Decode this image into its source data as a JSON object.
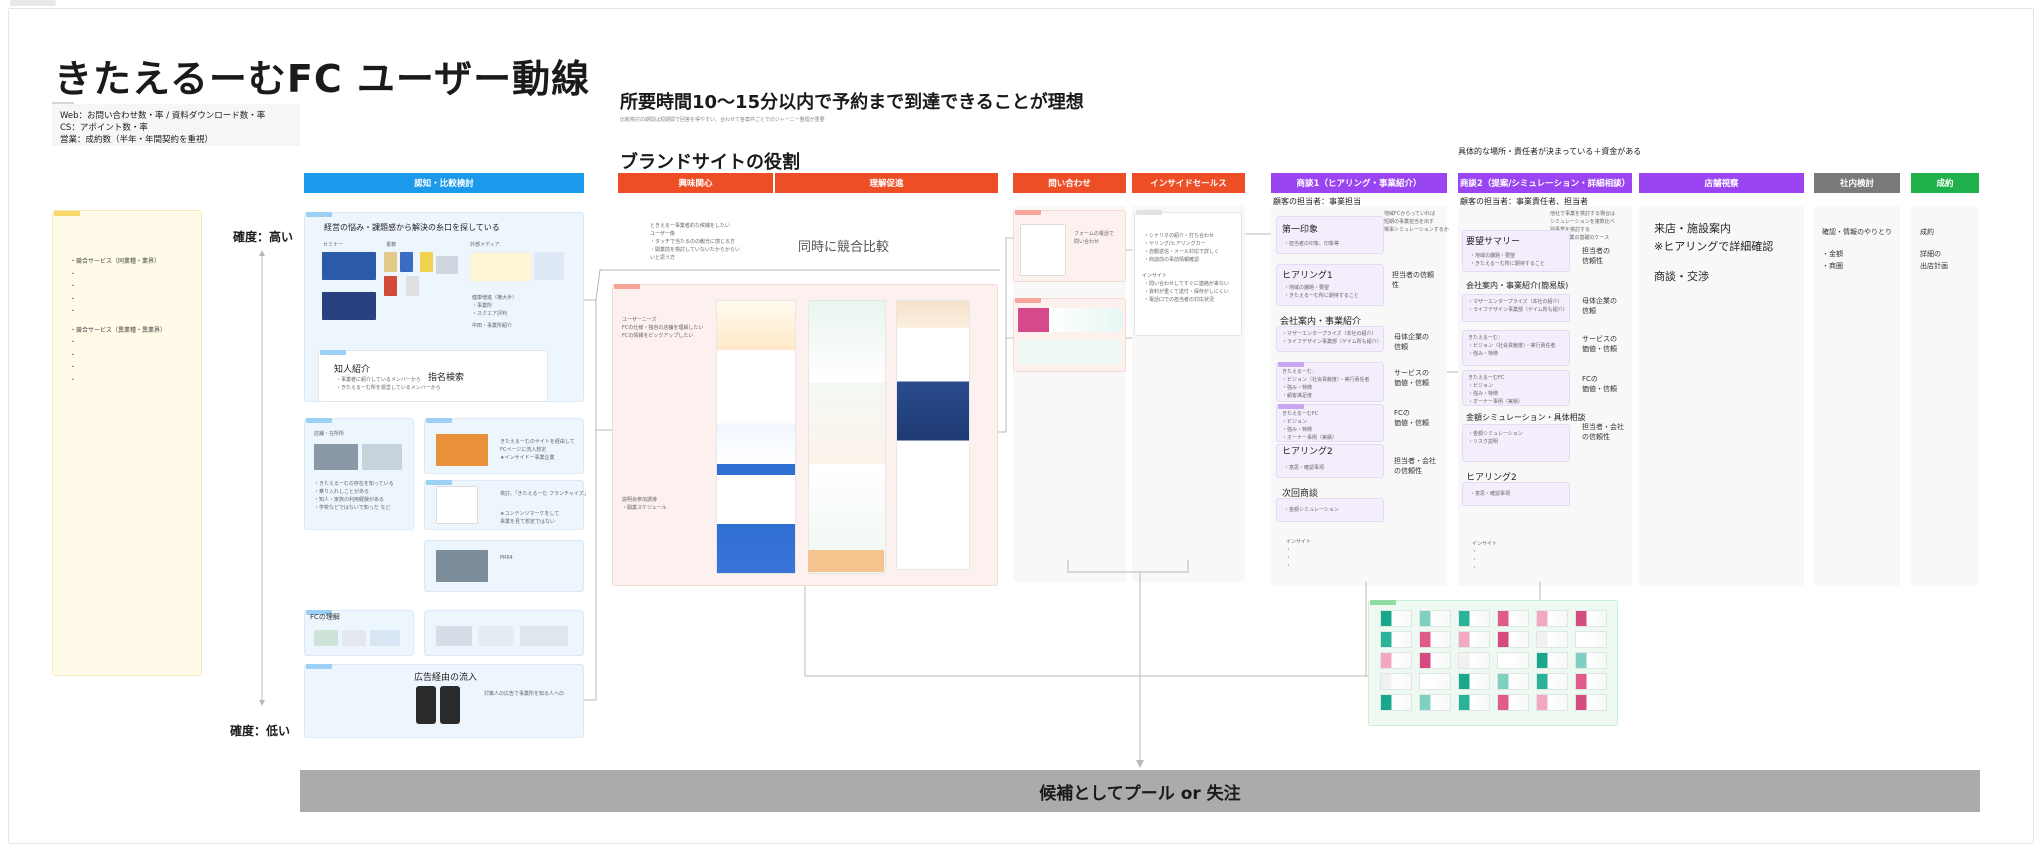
{
  "title": "きたえるーむFC ユーザー動線",
  "kpi": {
    "lines": [
      "Web：お問い合わせ数・率 / 資料ダウンロード数・率",
      "CS：アポイント数・率",
      "営業：成約数（半年・年間契約を重視）"
    ]
  },
  "lead": {
    "headline": "所要時間10〜15分以内で予約まで到達できることが理想",
    "sub": "比較検討の期間は短期間で回答を得やすい、合わせて各案件ごとでのジャーニー整理が重要"
  },
  "brand_heading": "ブランドサイトの役割",
  "precondition": "具体的な場所・責任者が決まっている＋資金がある",
  "confidence": {
    "high": "確度：高い",
    "low": "確度：低い"
  },
  "stages": [
    {
      "label": "認知・比較検討",
      "color": "#1b9aec"
    },
    {
      "label": "興味関心",
      "color": "#ee4e26"
    },
    {
      "label": "理解促進",
      "color": "#ee4e26"
    },
    {
      "label": "問い合わせ",
      "color": "#ee4e26"
    },
    {
      "label": "インサイドセールス",
      "color": "#ee4e26"
    },
    {
      "label": "商談1（ヒアリング・事業紹介）",
      "color": "#9b45f2"
    },
    {
      "label": "商談2（提案/シミュレーション・詳細相談）",
      "color": "#9b45f2"
    },
    {
      "label": "店舗視察",
      "color": "#9b45f2"
    },
    {
      "label": "社内検討",
      "color": "#7a7a7a"
    },
    {
      "label": "成約",
      "color": "#1fb24c"
    }
  ],
  "competitors": {
    "items": [
      "・競合サービス（同業種・業界）",
      "・",
      "・",
      "・",
      "・",
      "・競合サービス（異業種・異業界）",
      "・",
      "・",
      "・",
      "・"
    ]
  },
  "awareness": {
    "main_heading": "経営の悩み・課題感から解決の糸口を探している",
    "labels": {
      "seminar": "セミナー",
      "books": "書籍",
      "media": "外部メディア"
    },
    "media_lines": [
      "健康増進（横大手）",
      "・事業所",
      "・スクエア評判"
    ],
    "media_note": "中田・事業所紹介",
    "referral_title": "知人紹介",
    "referral_lines": [
      "・事業者に紹介しているメンバーから",
      "・きたえるーむ所を運営しているメンバーから"
    ],
    "search_label": "指名検索",
    "store_label": "店舗・在所所",
    "store_lines": [
      "・きたえるーむの存在を知っている",
      "・乗り入れしことがある",
      "・知人・家族の利用経験がある",
      "・学校などではないで知っだ など"
    ],
    "site_lines": [
      "きたえるーむのサイトを経由して",
      "FCページに流入想定",
      "★インサイドー事業企業"
    ],
    "search_query": "検討。「きたえるーむ フランチャイズ」",
    "search_notes": [
      "★コンテンツマーケをして",
      "事業を見て想定ではない"
    ],
    "press_label": "PR64",
    "fc_label": "FCの理解",
    "ad_title": "広告経由の流入",
    "ad_note": "対策人の広告で事業所を知る人への"
  },
  "compare_note": "同時に競合比較",
  "interest": {
    "lines": [
      "ときえるー事業者的な候補をしたい",
      "ユーザー像",
      "・タッチで当たるのの観光に感じる方",
      "・開業前を検討していないたからからい",
      "いと思う方"
    ],
    "tag_text": "ユーザーニーズ",
    "user_needs": [
      "ユーザーニーズ",
      "FCの仕様・独自の店舗を理解したい",
      "FCの情報をピックアップしたい"
    ],
    "schedule_lines": [
      "説明会参加誘導",
      "・開業スケジュール"
    ]
  },
  "inquiry": {
    "form_text": [
      "フォームの電話で",
      "問い合わせ"
    ]
  },
  "inside_sales": {
    "lines": [
      "・シナリオの紹介・打ち合わせ",
      "・ヤリング/ヒアリングカー",
      "・自動返信・メール対応で詳しく",
      "・商談前の事前情報確認"
    ],
    "insight_title": "インサイト",
    "insight_lines": [
      "・問い合わせしてすぐに連絡が来ない",
      "・資料が重くて送付・保存がしにくい",
      "・電話口での担当者の対応状況"
    ]
  },
  "meeting1": {
    "heading": "顧客の担当者：事業担当",
    "top_note": [
      "地域FCからっていれば",
      "短期の事業担当を出す",
      "場事シミュレーションするか"
    ],
    "first_impression": "第一印象",
    "first_lines": [
      "・担当者の印象、印象等"
    ],
    "hearing1": "ヒアリング1",
    "hearing1_lines": [
      "・地域の課題・要望",
      "・きたえるーむ所に期待すること"
    ],
    "company_intro": "会社案内・事業紹介",
    "company_lines": [
      "・マザーエンタープライズ（本社の紹介）",
      "・ライフデザイン事業部（ゲイム所も紹介）"
    ],
    "kitaeru_lines": [
      "きたえるーむ：",
      "・ビジョン（社会貢献度）・実行責任者",
      "・強み・特徴",
      "・顧客満足度"
    ],
    "fc_lines": [
      "きたえるーむFC",
      "・ビジョン",
      "・強み・特徴",
      "・オーナー事例（実績）"
    ],
    "hearing2": "ヒアリング2",
    "hearing2_lines": [
      "・意思・確認事項"
    ],
    "next_meeting": "次回商談",
    "next_lines": [
      "・金額シミュレーション"
    ],
    "trust_rep": "担当者の信頼性",
    "trust_parent": [
      "母体企業の",
      "信頼"
    ],
    "trust_service": [
      "サービスの",
      "価値・信頼"
    ],
    "trust_fc": [
      "FCの",
      "価値・信頼"
    ],
    "trust_company": [
      "担当者・会社",
      "の信頼性"
    ],
    "insight_lines": [
      "インサイト",
      "・",
      "・",
      "・"
    ]
  },
  "meeting2": {
    "heading": "顧客の担当者：事業責任者、担当者",
    "top_note": [
      "他社で事業を検討する場合は",
      "シミュレーションを複数比べ",
      "別事業を検討する",
      "★投資事業の基礎のケース"
    ],
    "summary": "要望サマリー",
    "summary_lines": [
      "・地域の課題・要望",
      "・きたえるーむ所に期待すること"
    ],
    "simple_intro": "会社案内・事業紹介(簡易版)",
    "simple_lines": [
      "・マザーエンタープライズ（本社の紹介）",
      "・ライフデザイン事業部（ゲイム所も紹介）"
    ],
    "kitaeru_lines": [
      "きたえるーむ：",
      "・ビジョン（社会貢献度）・実行責任者",
      "・強み・特徴"
    ],
    "fc_lines": [
      "きたえるーむFC",
      "・ビジョン",
      "・強み・特徴",
      "・オーナー事例（実績）"
    ],
    "simulation": "金額シミュレーション・具体相談",
    "simulation_lines": [
      "・金額シミュレーション",
      "・リスク説明"
    ],
    "hearing2": "ヒアリング2",
    "hearing2_lines": [
      "・意思・確認事項"
    ],
    "trust_rep": [
      "担当者の",
      "信頼性"
    ],
    "trust_parent": [
      "母体企業の",
      "信頼"
    ],
    "trust_service": [
      "サービスの",
      "価値・信頼"
    ],
    "trust_fc": [
      "FCの",
      "価値・信頼"
    ],
    "trust_company": [
      "担当者・会社",
      "の信頼性"
    ],
    "insight_lines": [
      "インサイト",
      "・",
      "・",
      "・"
    ]
  },
  "visit": {
    "lines": [
      "来店・施設案内",
      "※ヒアリングで詳細確認",
      "",
      "商談・交渉"
    ]
  },
  "internal": {
    "lines": [
      "確認・情報のやりとり",
      "",
      "・金額",
      "・商圏"
    ]
  },
  "contract": {
    "lines": [
      "成約",
      "",
      "詳細の",
      "出店計画"
    ]
  },
  "pool": "候補としてプール or 失注",
  "colors": {
    "blue": "#1b9aec",
    "red": "#ee4e26",
    "purple": "#9b45f2",
    "gray": "#7a7a7a",
    "green": "#1fb24c"
  }
}
